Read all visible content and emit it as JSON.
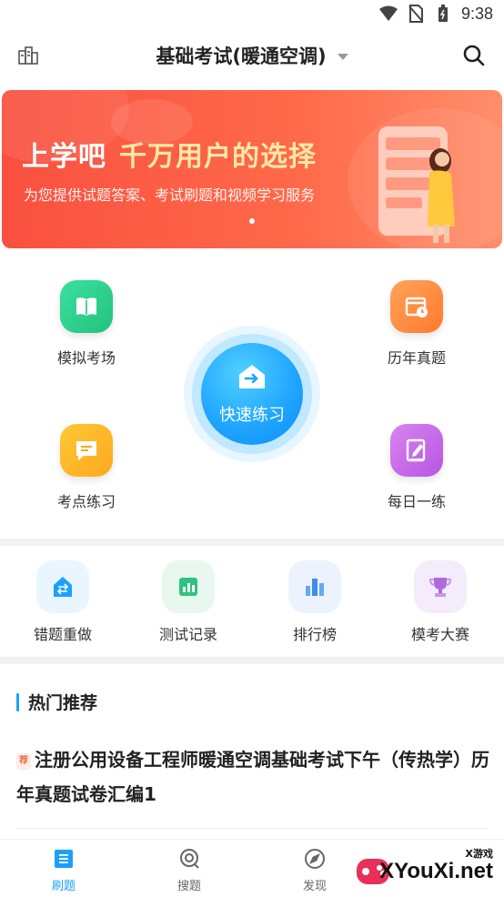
{
  "status_bar": {
    "time": "9:38",
    "icons": [
      "wifi-icon",
      "no-sim-icon",
      "battery-icon"
    ]
  },
  "header": {
    "title": "基础考试(暖通空调)",
    "left_icon": "buildings-icon",
    "right_icon": "search-icon"
  },
  "banner": {
    "headline_part1": "上学吧",
    "headline_part2": "千万用户的选择",
    "subtitle": "为您提供试题答案、考试刷题和视频学习服务"
  },
  "features": [
    {
      "label": "模拟考场",
      "icon": "book-icon",
      "color": "#2ecf8e"
    },
    {
      "label": "历年真题",
      "icon": "calendar-clock-icon",
      "color": "#ff8a3d"
    },
    {
      "label": "考点练习",
      "icon": "message-icon",
      "color": "#ffb21e"
    },
    {
      "label": "每日一练",
      "icon": "edit-icon",
      "color": "#c56ae8"
    }
  ],
  "quick_practice": {
    "label": "快速练习",
    "icon": "arrow-house-icon"
  },
  "tools": [
    {
      "label": "错题重做",
      "icon": "redo-icon",
      "color": "#1aa0ff"
    },
    {
      "label": "测试记录",
      "icon": "chart-icon",
      "color": "#2ec27e"
    },
    {
      "label": "排行榜",
      "icon": "ranking-icon",
      "color": "#3f8cf0"
    },
    {
      "label": "模考大赛",
      "icon": "trophy-icon",
      "color": "#b06ae0"
    }
  ],
  "hot": {
    "title": "热门推荐",
    "article_tag": "荐",
    "article_title": "注册公用设备工程师暖通空调基础考试下午（传热学）历年真题试卷汇编1"
  },
  "tabbar": {
    "items": [
      {
        "label": "刷题",
        "icon": "list-icon",
        "active": true
      },
      {
        "label": "搜题",
        "icon": "search-icon",
        "active": false
      },
      {
        "label": "发现",
        "icon": "compass-icon",
        "active": false
      }
    ]
  },
  "watermark": {
    "main": "XYouXi.net",
    "sub": "X游戏"
  }
}
